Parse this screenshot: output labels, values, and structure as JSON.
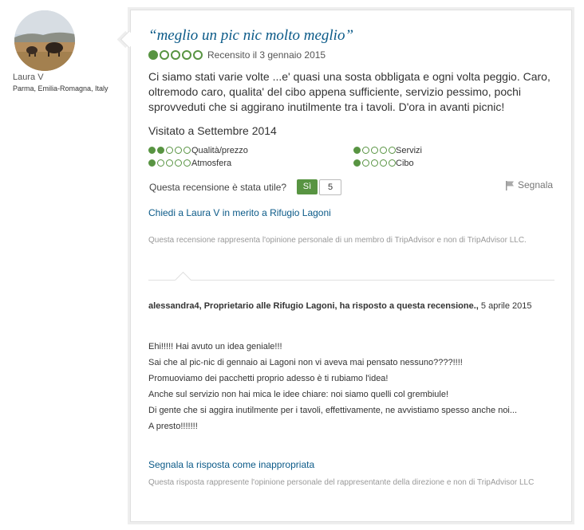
{
  "reviewer": {
    "name": "Laura V",
    "location": "Parma, Emilia-Romagna, Italy"
  },
  "review": {
    "title": "“meglio un pic nic molto meglio”",
    "rating": 1,
    "reviewed_date": "Recensito il 3 gennaio 2015",
    "body": "Ci siamo stati varie volte ...e' quasi una sosta obbligata e ogni volta peggio. Caro, oltremodo caro, qualita' del cibo appena sufficiente, servizio pessimo, pochi sprovveduti che si aggirano inutilmente tra i tavoli. D'ora in avanti picnic!",
    "visited": "Visitato a Settembre 2014",
    "subratings": [
      {
        "label": "Qualità/prezzo",
        "rating": 2
      },
      {
        "label": "Servizi",
        "rating": 1
      },
      {
        "label": "Atmosfera",
        "rating": 1
      },
      {
        "label": "Cibo",
        "rating": 1
      }
    ],
    "helpful_question": "Questa recensione è stata utile?",
    "yes_label": "Sì",
    "helpful_count": "5",
    "report_label": "Segnala",
    "ask_link": "Chiedi a Laura V in merito a Rifugio Lagoni",
    "disclaimer": "Questa recensione rappresenta l'opinione personale di un membro di TripAdvisor e non di TripAdvisor LLC."
  },
  "response": {
    "author_line": "alessandra4, Proprietario alle Rifugio Lagoni, ha risposto a questa recensione.,",
    "date": "5 aprile 2015",
    "lines": [
      "Ehi!!!!! Hai avuto un idea geniale!!!",
      "Sai che al pic-nic di gennaio ai Lagoni non vi aveva mai pensato nessuno????!!!!",
      "Promuoviamo dei pacchetti proprio adesso è ti rubiamo l'idea!",
      "Anche sul servizio non hai mica le idee chiare: noi siamo quelli col grembiule!",
      "Di gente che si aggira inutilmente per i tavoli, effettivamente, ne avvistiamo spesso anche noi...",
      "A presto!!!!!!!"
    ],
    "report_link": "Segnala la risposta come inappropriata",
    "disclaimer": "Questa risposta rappresente l'opinione personale del rappresentante della direzione e non di TripAdvisor LLC"
  },
  "colors": {
    "bubble_green": "#589442",
    "link_blue": "#0b5a88"
  }
}
